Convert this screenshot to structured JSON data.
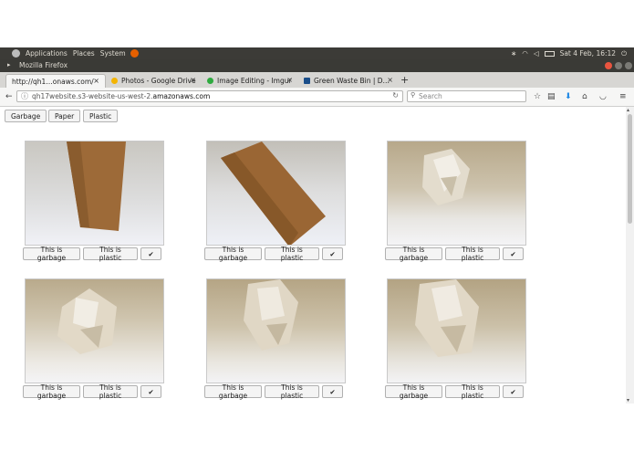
{
  "panel": {
    "applications": "Applications",
    "places": "Places",
    "system": "System",
    "datetime": "Sat  4 Feb, 16:12"
  },
  "window": {
    "title": "Mozilla Firefox"
  },
  "tabs": [
    {
      "label": "http://qh1…onaws.com/",
      "active": true
    },
    {
      "label": "Photos - Google Drive",
      "active": false
    },
    {
      "label": "Image Editing - Imgur",
      "active": false
    },
    {
      "label": "Green Waste Bin | D…",
      "active": false
    }
  ],
  "nav": {
    "url_prefix": "qh17website.s3-website-us-west-2.",
    "url_domain": "amazonaws.com",
    "search_placeholder": "Search"
  },
  "categories": [
    "Garbage",
    "Paper",
    "Plastic"
  ],
  "cards": [
    {
      "image": "cardboard-strip",
      "garbage_label": "This is garbage",
      "plastic_label": "This is plastic",
      "confirm_label": "✔"
    },
    {
      "image": "cardboard-strip-tilted",
      "garbage_label": "This is garbage",
      "plastic_label": "This is plastic",
      "confirm_label": "✔"
    },
    {
      "image": "crumpled-paper",
      "garbage_label": "This is garbage",
      "plastic_label": "This is plastic",
      "confirm_label": "✔"
    },
    {
      "image": "crumpled-paper",
      "garbage_label": "This is garbage",
      "plastic_label": "This is plastic",
      "confirm_label": "✔"
    },
    {
      "image": "crumpled-paper",
      "garbage_label": "This is garbage",
      "plastic_label": "This is plastic",
      "confirm_label": "✔"
    },
    {
      "image": "crumpled-paper",
      "garbage_label": "This is garbage",
      "plastic_label": "This is plastic",
      "confirm_label": "✔"
    }
  ],
  "colors": {
    "panel": "#3c3b37",
    "tabstrip": "#d7d6d3",
    "firefox": "#e66000",
    "download_arrow": "#1e88e5"
  }
}
